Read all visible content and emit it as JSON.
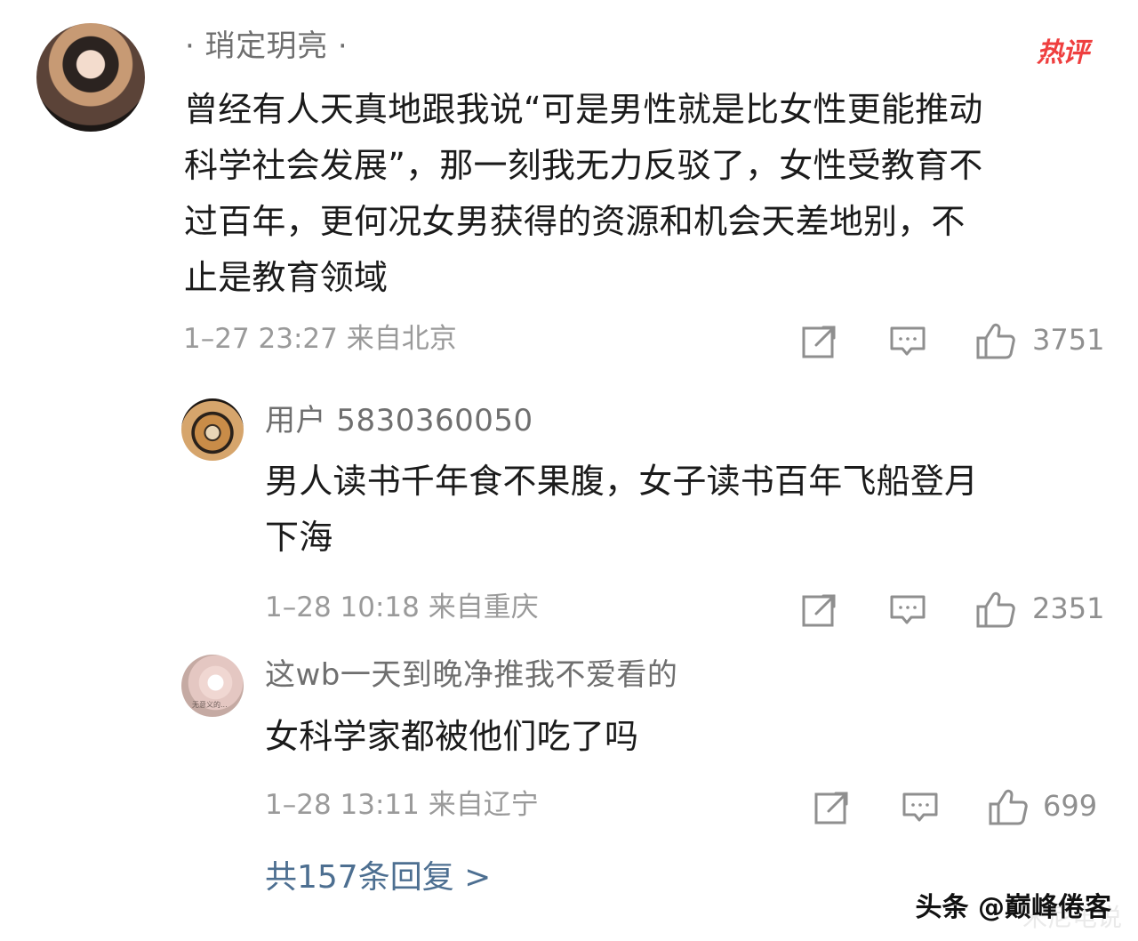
{
  "post": {
    "username": "· 琑定玥亮 ·",
    "badge": "热评",
    "content": [
      "曾经有人天真地跟我说“可是男性就是比女性更能推动",
      "科学社会发展”，那一刻我无力反驳了，女性受教育不",
      "过百年，更何况女男获得的资源和机会天差地别，不",
      "止是教育领域"
    ],
    "meta": "1–27 23:27 来自北京",
    "likes": "3751"
  },
  "comments": [
    {
      "username": "用户 5830360050",
      "content": [
        "男人读书千年食不果腹，女子读书百年飞船登月",
        "下海"
      ],
      "meta": "1–28 10:18 来自重庆",
      "likes": "2351"
    },
    {
      "username": "这wb一天到晚净推我不爱看的",
      "content": [
        "女科学家都被他们吃了吗"
      ],
      "meta": "1–28 13:11 来自辽宁",
      "likes": "699",
      "avatar_text": "无意义的..."
    }
  ],
  "replies_label": "共157条回复 >",
  "watermark": "头条 @巅峰倦客",
  "faint_watermark": "米尼电说",
  "icons": {
    "share": "share-icon",
    "comment": "comment-icon",
    "like": "thumbs-up-icon"
  }
}
